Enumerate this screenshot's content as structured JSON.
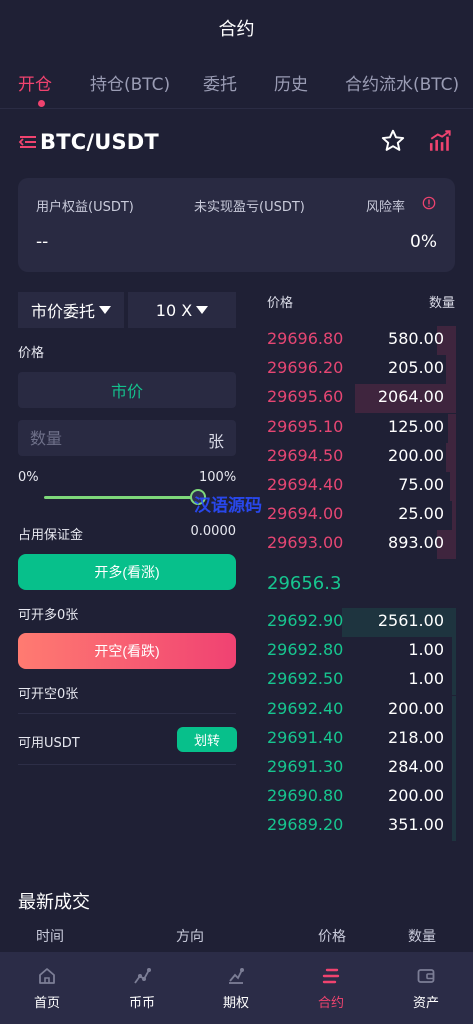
{
  "header": {
    "title": "合约"
  },
  "tabs": [
    {
      "label": "开仓",
      "active": true
    },
    {
      "label": "持仓(BTC)",
      "active": false
    },
    {
      "label": "委托",
      "active": false
    },
    {
      "label": "历史",
      "active": false
    },
    {
      "label": "合约流水(BTC)",
      "active": false
    }
  ],
  "symbol": "BTC/USDT",
  "account": {
    "equity_label": "用户权益(USDT)",
    "equity_value": "--",
    "unrealized_label": "未实现盈亏(USDT)",
    "risk_label": "风险率",
    "risk_value": "0%"
  },
  "order_form": {
    "order_type": "市价委托",
    "leverage": "10 X",
    "price_label": "价格",
    "market_label": "市价",
    "qty_placeholder": "数量",
    "qty_unit": "张",
    "pct_min": "0%",
    "pct_max": "100%",
    "slider_fraction": 1.0,
    "margin_label": "占用保证金",
    "margin_value": "0.0000",
    "long_button": "开多(看涨)",
    "long_available": "可开多0张",
    "short_button": "开空(看跌)",
    "short_available": "可开空0张",
    "available_label": "可用USDT",
    "transfer_button": "划转"
  },
  "orderbook": {
    "price_header": "价格",
    "qty_header": "数量",
    "asks": [
      {
        "price": "29696.80",
        "qty": "580.00",
        "depth": 0.1
      },
      {
        "price": "29696.20",
        "qty": "205.00",
        "depth": 0.05
      },
      {
        "price": "29695.60",
        "qty": "2064.00",
        "depth": 0.53
      },
      {
        "price": "29695.10",
        "qty": "125.00",
        "depth": 0.04
      },
      {
        "price": "29694.50",
        "qty": "200.00",
        "depth": 0.05
      },
      {
        "price": "29694.40",
        "qty": "75.00",
        "depth": 0.03
      },
      {
        "price": "29694.00",
        "qty": "25.00",
        "depth": 0.02
      },
      {
        "price": "29693.00",
        "qty": "893.00",
        "depth": 0.1
      }
    ],
    "last_price": "29656.3",
    "bids": [
      {
        "price": "29692.90",
        "qty": "2561.00",
        "depth": 0.6
      },
      {
        "price": "29692.80",
        "qty": "1.00",
        "depth": 0.02
      },
      {
        "price": "29692.50",
        "qty": "1.00",
        "depth": 0.02
      },
      {
        "price": "29692.40",
        "qty": "200.00",
        "depth": 0.02
      },
      {
        "price": "29691.40",
        "qty": "218.00",
        "depth": 0.02
      },
      {
        "price": "29691.30",
        "qty": "284.00",
        "depth": 0.02
      },
      {
        "price": "29690.80",
        "qty": "200.00",
        "depth": 0.02
      },
      {
        "price": "29689.20",
        "qty": "351.00",
        "depth": 0.02
      }
    ]
  },
  "watermark": "汉语源码",
  "trades": {
    "title": "最新成交",
    "headers": [
      "时间",
      "方向",
      "价格",
      "数量"
    ]
  },
  "nav": [
    {
      "label": "首页",
      "icon": "home-icon",
      "active": false
    },
    {
      "label": "币币",
      "icon": "spot-icon",
      "active": false
    },
    {
      "label": "期权",
      "icon": "option-icon",
      "active": false
    },
    {
      "label": "合约",
      "icon": "contract-icon",
      "active": true
    },
    {
      "label": "资产",
      "icon": "wallet-icon",
      "active": false
    }
  ],
  "colors": {
    "background": "#1f2035",
    "accent": "#f0436f",
    "up": "#17c58f",
    "down": "#e64673"
  }
}
